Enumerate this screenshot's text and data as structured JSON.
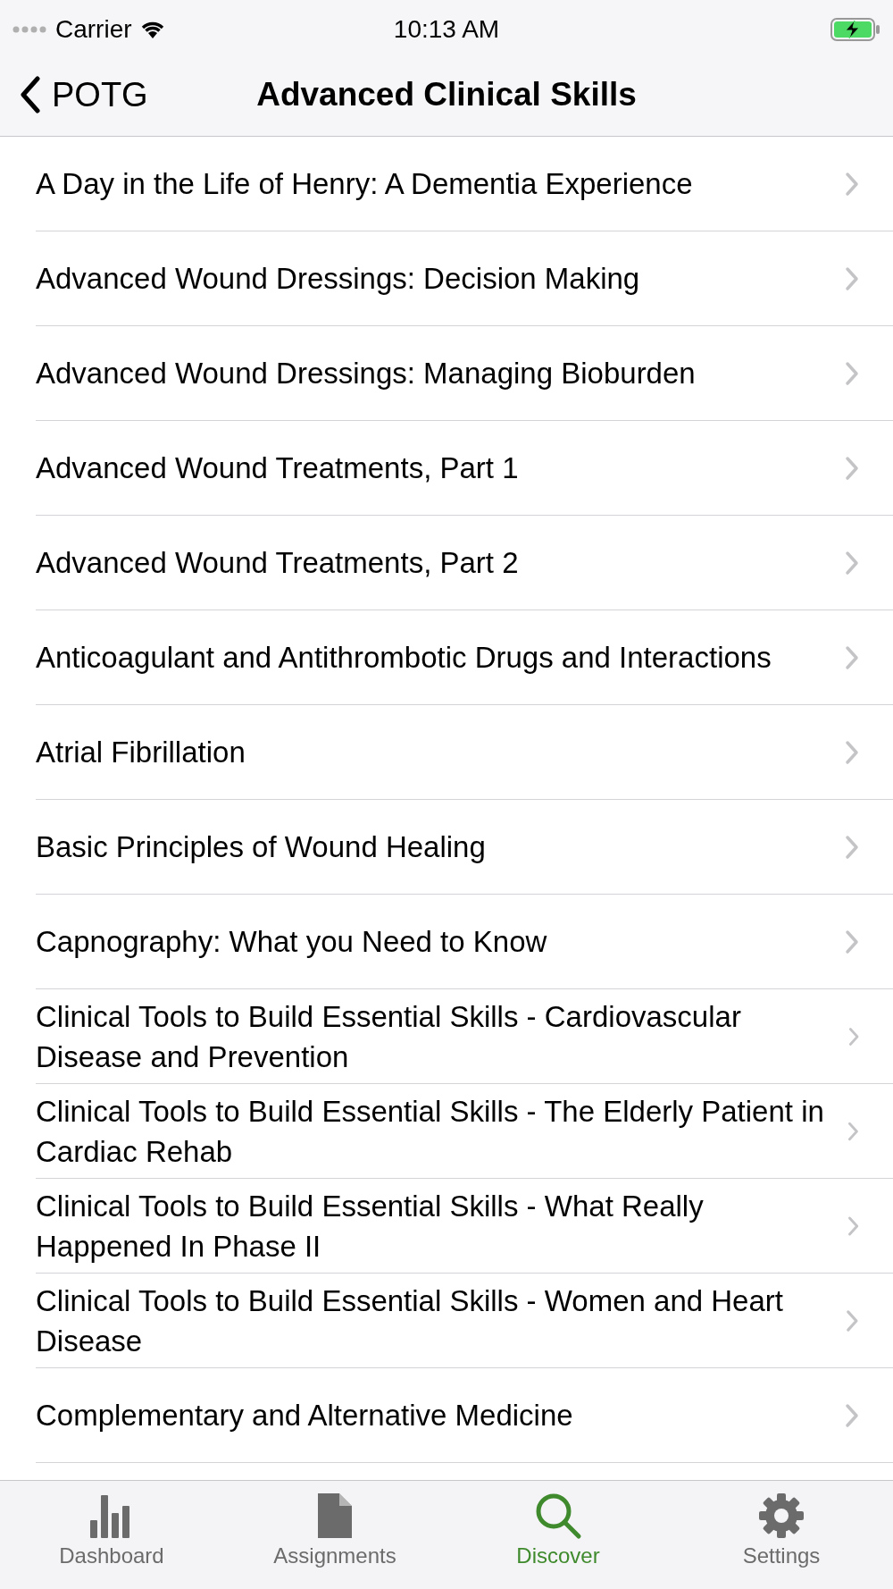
{
  "status_bar": {
    "carrier": "Carrier",
    "time": "10:13 AM",
    "charging": true
  },
  "nav_bar": {
    "back_label": "POTG",
    "title": "Advanced Clinical Skills"
  },
  "list": [
    {
      "title": "A Day in the Life of Henry: A Dementia Experience"
    },
    {
      "title": "Advanced Wound Dressings: Decision Making"
    },
    {
      "title": "Advanced Wound Dressings: Managing Bioburden"
    },
    {
      "title": "Advanced Wound Treatments, Part 1"
    },
    {
      "title": "Advanced Wound Treatments, Part 2"
    },
    {
      "title": "Anticoagulant and Antithrombotic Drugs and Interactions"
    },
    {
      "title": "Atrial Fibrillation"
    },
    {
      "title": "Basic Principles of Wound Healing"
    },
    {
      "title": "Capnography: What you Need to Know"
    },
    {
      "title": "Clinical Tools to Build Essential Skills - Cardiovascular Disease and Prevention"
    },
    {
      "title": "Clinical Tools to Build Essential Skills - The Elderly Patient in Cardiac Rehab"
    },
    {
      "title": "Clinical Tools to Build Essential Skills - What Really Happened In Phase II"
    },
    {
      "title": "Clinical Tools to Build Essential Skills - Women and Heart Disease"
    },
    {
      "title": "Complementary and Alternative Medicine"
    }
  ],
  "tab_bar": [
    {
      "kind": "dashboard",
      "label": "Dashboard",
      "selected": false
    },
    {
      "kind": "assignments",
      "label": "Assignments",
      "selected": false
    },
    {
      "kind": "discover",
      "label": "Discover",
      "selected": true
    },
    {
      "kind": "settings",
      "label": "Settings",
      "selected": false
    }
  ]
}
